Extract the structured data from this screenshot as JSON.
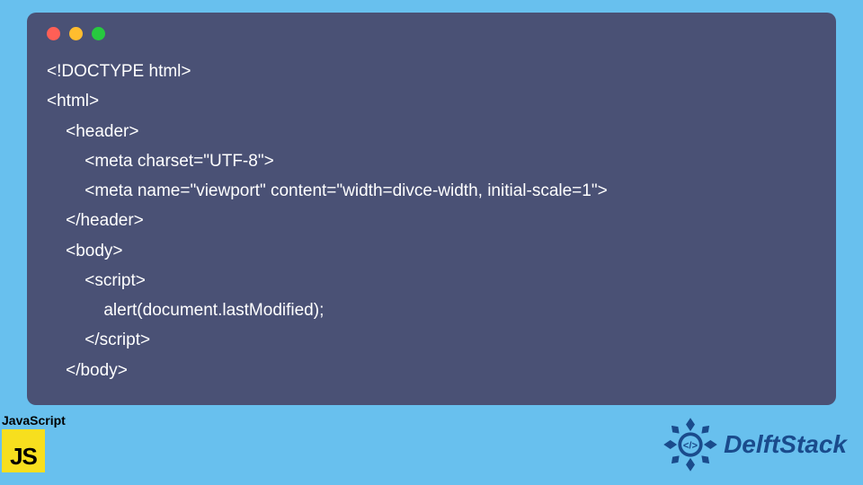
{
  "code": {
    "lines": [
      "<!DOCTYPE html>",
      "<html>",
      "    <header>",
      "        <meta charset=\"UTF-8\">",
      "        <meta name=\"viewport\" content=\"width=divce-width, initial-scale=1\">",
      "    </header>",
      "    <body>",
      "        <script>",
      "            alert(document.lastModified);",
      "        </script>",
      "    </body>"
    ]
  },
  "js_badge": {
    "label": "JavaScript",
    "logo_text": "JS"
  },
  "brand": {
    "name": "DelftStack"
  },
  "colors": {
    "page_bg": "#68c0ee",
    "window_bg": "#4a5175",
    "code_text": "#ffffff",
    "dot_red": "#ff5f56",
    "dot_yellow": "#ffbd2e",
    "dot_green": "#27c93f",
    "js_yellow": "#f7df1e",
    "brand_blue": "#1a4b8c"
  }
}
